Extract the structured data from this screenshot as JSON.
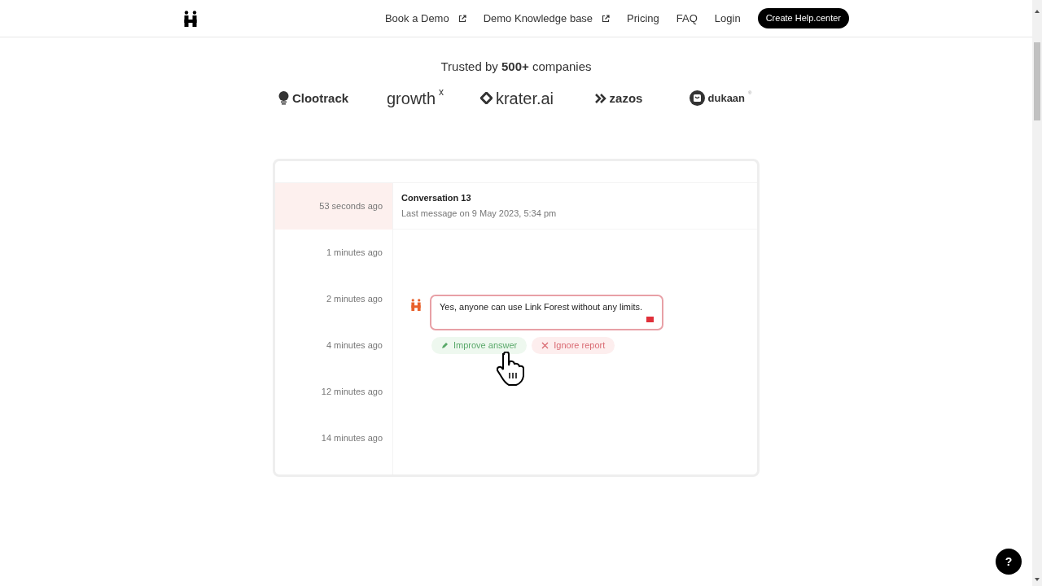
{
  "nav": {
    "links": [
      {
        "label": "Book a Demo",
        "external": true
      },
      {
        "label": "Demo Knowledge base",
        "external": true
      },
      {
        "label": "Pricing",
        "external": false
      },
      {
        "label": "FAQ",
        "external": false
      },
      {
        "label": "Login",
        "external": false
      }
    ],
    "cta": "Create Help.center"
  },
  "trusted": {
    "heading": "Trusted by **500+** companies",
    "logos": [
      {
        "kind": "bulb",
        "name": "Clootrack"
      },
      {
        "kind": "super",
        "name": "growth",
        "sup": "x"
      },
      {
        "kind": "diamond",
        "name": "krater.ai"
      },
      {
        "kind": "chevrons",
        "name": "zazos"
      },
      {
        "kind": "bag",
        "name": "dukaan",
        "mark": "®"
      }
    ]
  },
  "demo": {
    "times": [
      {
        "label": "53 seconds ago",
        "selected": true
      },
      {
        "label": "1 minutes ago",
        "selected": false
      },
      {
        "label": "2 minutes ago",
        "selected": false
      },
      {
        "label": "4 minutes ago",
        "selected": false
      },
      {
        "label": "12 minutes ago",
        "selected": false
      },
      {
        "label": "14 minutes ago",
        "selected": false
      }
    ],
    "conversation": {
      "title": "Conversation 13",
      "subtitle": "Last message on 9 May 2023, 5:34 pm"
    },
    "answer": {
      "text": "Yes, anyone can use Link Forest without any limits.",
      "flagged": true
    },
    "actions": [
      {
        "kind": "improve",
        "label": "Improve answer"
      },
      {
        "kind": "ignore",
        "label": "Ignore report"
      }
    ]
  },
  "help": {
    "label": "?"
  }
}
